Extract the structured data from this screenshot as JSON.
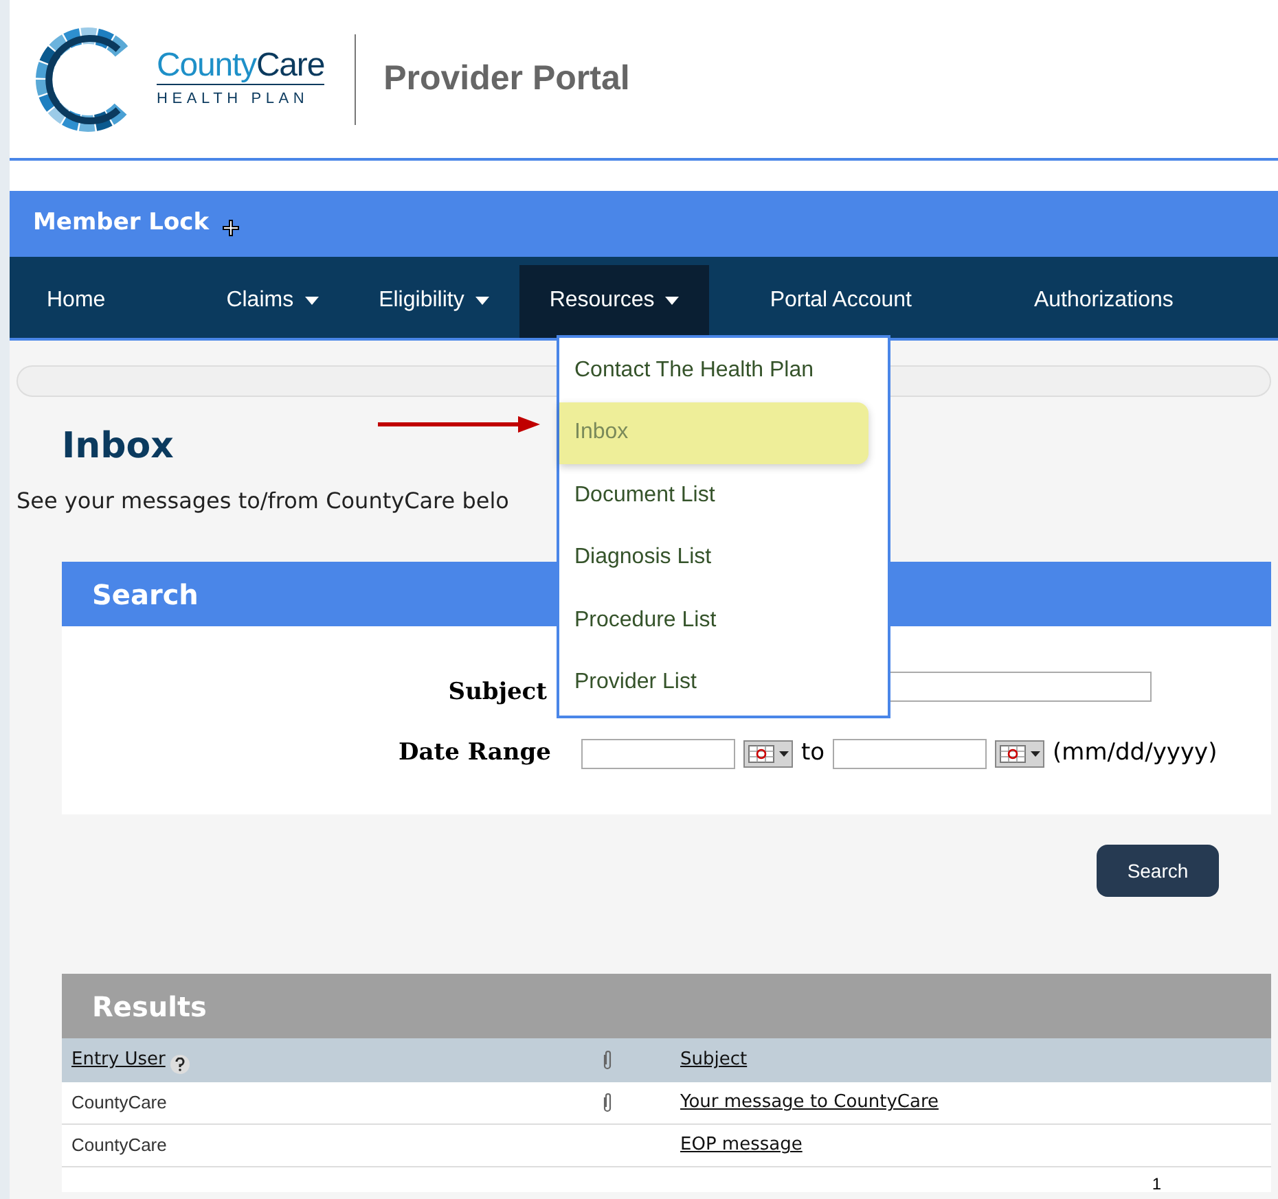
{
  "logo": {
    "brand_first": "County",
    "brand_second": "Care",
    "tagline": "HEALTH PLAN"
  },
  "portal_title": "Provider Portal",
  "member_lock": {
    "label": "Member Lock"
  },
  "nav": [
    {
      "label": "Home",
      "has_menu": false,
      "selected": false
    },
    {
      "label": "Claims",
      "has_menu": true,
      "selected": false
    },
    {
      "label": "Eligibility",
      "has_menu": true,
      "selected": false
    },
    {
      "label": "Resources",
      "has_menu": true,
      "selected": true
    },
    {
      "label": "Portal Account",
      "has_menu": false,
      "selected": false
    },
    {
      "label": "Authorizations",
      "has_menu": false,
      "selected": false
    }
  ],
  "resources_menu": [
    {
      "label": "Contact The Health Plan",
      "selected": false
    },
    {
      "label": "Inbox",
      "selected": true
    },
    {
      "label": "Document List",
      "selected": false
    },
    {
      "label": "Diagnosis List",
      "selected": false
    },
    {
      "label": "Procedure List",
      "selected": false
    },
    {
      "label": "Provider List",
      "selected": false
    }
  ],
  "page_title": "Inbox",
  "description": "See your messages to/from CountyCare belo",
  "search": {
    "title": "Search",
    "subject_label": "Subject",
    "date_label": "Date Range",
    "to_label": "to",
    "date_hint": "(mm/dd/yyyy)",
    "button": "Search"
  },
  "results": {
    "title": "Results",
    "columns": [
      "Entry User",
      "Subject"
    ],
    "rows": [
      {
        "entry_user": "CountyCare",
        "attachment": true,
        "subject": "Your message to CountyCare"
      },
      {
        "entry_user": "CountyCare",
        "attachment": false,
        "subject": "EOP message"
      }
    ],
    "pager": "1"
  }
}
